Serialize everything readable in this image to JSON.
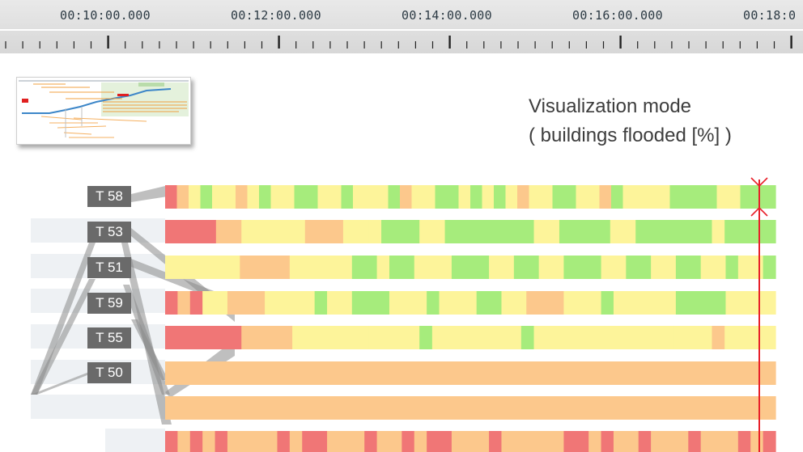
{
  "timeline": {
    "labels": [
      "00:10:00.000",
      "00:12:00.000",
      "00:14:00.000",
      "00:16:00.000",
      "00:18:0"
    ]
  },
  "mode": {
    "title": "Visualization mode",
    "subtitle": "( buildings flooded [%] )"
  },
  "tracks": [
    {
      "label": "T 58",
      "dominant": "mixed"
    },
    {
      "label": "T 53",
      "dominant": "mixed"
    },
    {
      "label": "T 51",
      "dominant": "mixed"
    },
    {
      "label": "T 59",
      "dominant": "mixed"
    },
    {
      "label": "T 55",
      "dominant": "mixed"
    },
    {
      "label": "T 50",
      "dominant": "orange"
    },
    {
      "label": "",
      "dominant": "orange"
    },
    {
      "label": "",
      "dominant": "orange-red"
    }
  ],
  "colors": {
    "timeline_bg": "#dcdcdc",
    "label_bg": "#6a6a6a",
    "cursor": "#e8202a",
    "link": "#8a8a8a",
    "lane_bg": "#eef1f4",
    "heat_green": "#a6ec7c",
    "heat_yellow": "#fdf49a",
    "heat_orange": "#fcc88c",
    "heat_red": "#f07676"
  }
}
